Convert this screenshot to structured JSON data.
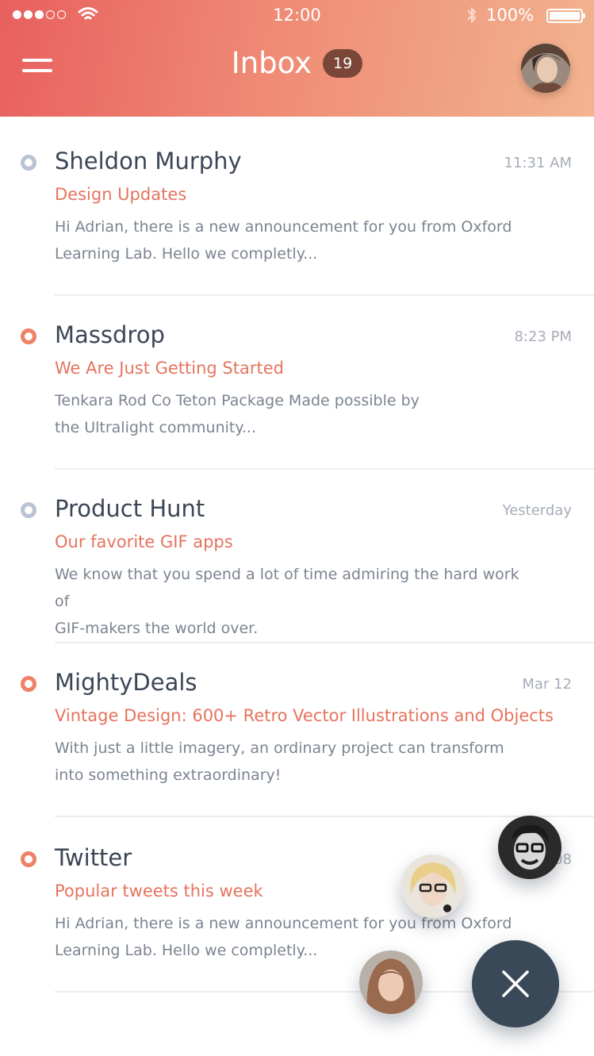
{
  "status_bar": {
    "time": "12:00",
    "battery": "100%"
  },
  "header": {
    "title": "Inbox",
    "unread_count": "19"
  },
  "messages": [
    {
      "sender": "Sheldon Murphy",
      "time": "11:31 AM",
      "subject": "Design Updates",
      "preview_line1": "Hi Adrian, there is a new announcement for you from Oxford",
      "preview_line2": "Learning  Lab. Hello we completly...",
      "indicator_color": "#b9c3d1"
    },
    {
      "sender": "Massdrop",
      "time": "8:23 PM",
      "subject": "We Are Just Getting Started",
      "preview_line1": "Tenkara Rod Co Teton Package Made possible by",
      "preview_line2": "the Ultralight community...",
      "indicator_color": "#ee8266"
    },
    {
      "sender": "Product Hunt",
      "time": "Yesterday",
      "subject": "Our favorite GIF apps",
      "preview_line1": "We know that you spend a lot of time admiring the hard work of",
      "preview_line2": "GIF-makers the world over.",
      "indicator_color": "#b9c3d1"
    },
    {
      "sender": "MightyDeals",
      "time": "Mar 12",
      "subject": "Vintage Design: 600+ Retro Vector Illustrations and Objects",
      "preview_line1": "With just a little imagery, an ordinary project can transform",
      "preview_line2": "into something extraordinary!",
      "indicator_color": "#ee8266"
    },
    {
      "sender": "Twitter",
      "time": "Mar 08",
      "subject": "Popular tweets this week",
      "preview_line1": "Hi Adrian, there is a new announcement for you from Oxford",
      "preview_line2": "Learning  Lab. Hello we completly...",
      "indicator_color": "#ee8266"
    }
  ],
  "colors": {
    "accent": "#e6735e",
    "fab": "#3a4958",
    "header_start": "#e8605e",
    "header_end": "#f2b48f"
  },
  "icons": {
    "menu": "hamburger-icon",
    "fab": "close-icon"
  }
}
